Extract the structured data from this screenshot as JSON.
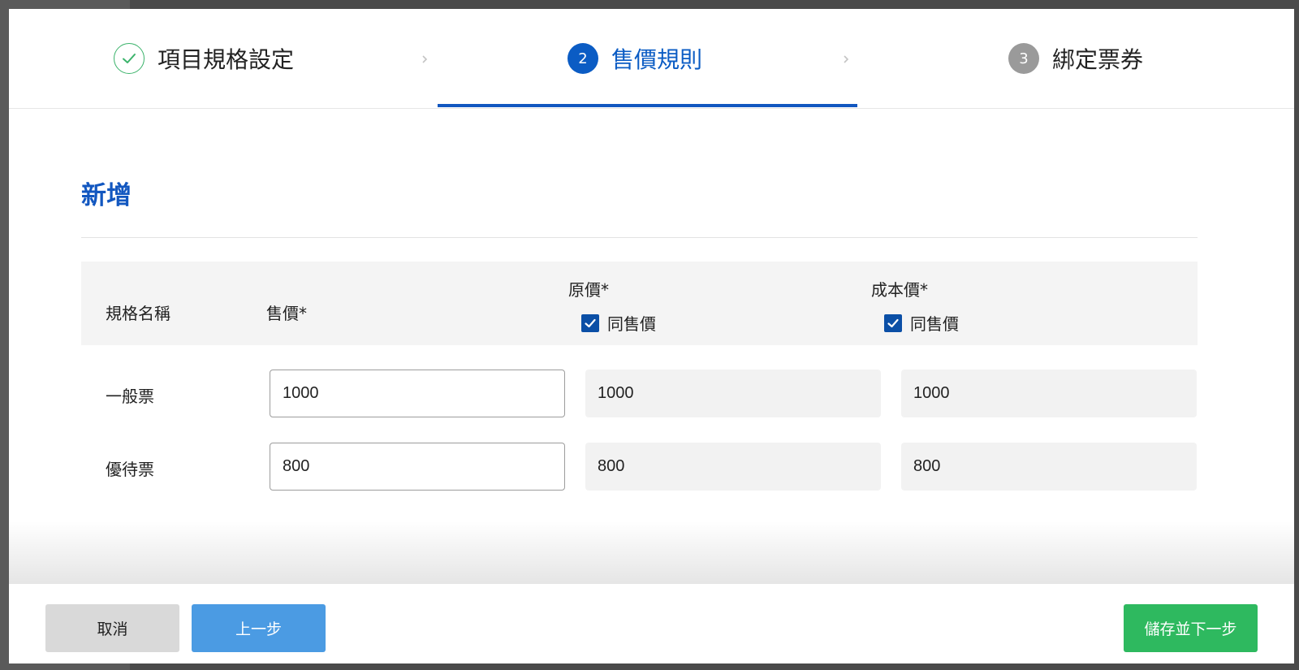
{
  "colors": {
    "accent": "#1257c0",
    "done": "#3bb36b",
    "pending": "#9a9a9a",
    "prev_button": "#4b9be3",
    "next_button": "#2eb95f"
  },
  "stepper": {
    "steps": [
      {
        "label": "項目規格設定",
        "state": "done",
        "icon": "check-icon"
      },
      {
        "label": "售價規則",
        "number": "2",
        "state": "active"
      },
      {
        "label": "綁定票券",
        "number": "3",
        "state": "pending"
      }
    ]
  },
  "section": {
    "title": "新增"
  },
  "table": {
    "headers": {
      "spec_name": "規格名稱",
      "sale_price": "售價*",
      "original_price": "原價*",
      "cost_price": "成本價*"
    },
    "same_as_sale_label": "同售價",
    "original_same_checked": true,
    "cost_same_checked": true,
    "rows": [
      {
        "name": "一般票",
        "sale": "1000",
        "original": "1000",
        "cost": "1000"
      },
      {
        "name": "優待票",
        "sale": "800",
        "original": "800",
        "cost": "800"
      }
    ]
  },
  "footer": {
    "cancel_label": "取消",
    "prev_label": "上一步",
    "next_label": "儲存並下一步"
  }
}
